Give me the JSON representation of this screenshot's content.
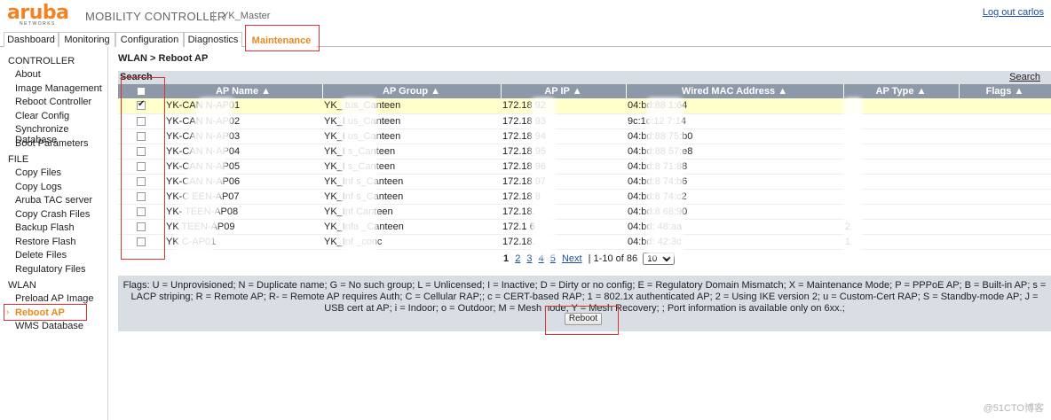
{
  "header": {
    "brand": "aruba",
    "brand_sub": "NETWORKS",
    "app_title": "MOBILITY CONTROLLER",
    "separator": "|",
    "controller_name": "YK_Master",
    "logout": "Log out carlos"
  },
  "tabs": [
    {
      "label": "Dashboard"
    },
    {
      "label": "Monitoring"
    },
    {
      "label": "Configuration"
    },
    {
      "label": "Diagnostics"
    },
    {
      "label": "Maintenance",
      "active": true
    }
  ],
  "sidebar": {
    "controller": {
      "title": "CONTROLLER",
      "items": [
        "About",
        "Image Management",
        "Reboot Controller",
        "Clear Config",
        "Synchronize Database",
        "Boot Parameters"
      ]
    },
    "file": {
      "title": "FILE",
      "items": [
        "Copy Files",
        "Copy Logs",
        "Aruba TAC server",
        "Copy Crash Files",
        "Backup Flash",
        "Restore Flash",
        "Delete Files",
        "Regulatory Files"
      ]
    },
    "wlan": {
      "title": "WLAN",
      "items": [
        "Preload AP Image",
        "Reboot AP",
        "WMS Database"
      ],
      "active_item": "Reboot AP",
      "active_marker": "›"
    }
  },
  "breadcrumb": "WLAN > Reboot AP",
  "search": {
    "left_label": "Search",
    "right_link": "Search"
  },
  "table": {
    "columns": [
      "",
      "AP Name ▲",
      "AP Group ▲",
      "AP IP ▲",
      "Wired MAC Address ▲",
      "AP Type ▲",
      "Flags ▲"
    ],
    "rows": [
      {
        "checked": true,
        "name": "YK-CAN      N-AP01",
        "group": "YK_      tus_Canteen",
        "ip": "172.18      92",
        "mac": "04:bd:88      1:64",
        "type": "",
        "flags": ""
      },
      {
        "checked": false,
        "name": "YK-CAN      N-AP02",
        "group": "YK_I      us_Canteen",
        "ip": "172.18      93",
        "mac": "9c:1c:12      7:14",
        "type": "",
        "flags": ""
      },
      {
        "checked": false,
        "name": "YK-CAN      N-AP03",
        "group": "YK_I      us_Canteen",
        "ip": "172.18      94",
        "mac": "04:bd:88      75:b0",
        "type": "",
        "flags": ""
      },
      {
        "checked": false,
        "name": "YK-CAN      N-AP04",
        "group": "YK_I      s_Canteen",
        "ip": "172.18      95",
        "mac": "04:bd:88      57:e8",
        "type": "",
        "flags": ""
      },
      {
        "checked": false,
        "name": "YK-CAN      N-AP05",
        "group": "YK_I      s_Canteen",
        "ip": "172.18      96",
        "mac": "04:bd:8      71:88",
        "type": "",
        "flags": ""
      },
      {
        "checked": false,
        "name": "YK-CAN      N-AP06",
        "group": "YK_Inf      s_Canteen",
        "ip": "172.18      97",
        "mac": "04:bd:8      74:b6",
        "type": "",
        "flags": ""
      },
      {
        "checked": false,
        "name": "YK-C      EEN-AP07",
        "group": "YK_Inf      s_Canteen",
        "ip": "172.18      8",
        "mac": "04:bd:8      74:c2",
        "type": "",
        "flags": ""
      },
      {
        "checked": false,
        "name": "YK-      TEEN-AP08",
        "group": "YK_Inf      Canteen",
        "ip": "172.18.",
        "mac": "04:bd:8      68:90",
        "type": "",
        "flags": ""
      },
      {
        "checked": false,
        "name": "YK      TEEN-AP09",
        "group": "YK_Infa      _Canteen",
        "ip": "172.1      6",
        "mac": "04:bd:      48:aa",
        "type": "2",
        "flags": ""
      },
      {
        "checked": false,
        "name": "YK      C-AP01",
        "group": "YK_Inf      _conc",
        "ip": "172.18.",
        "mac": "04:bd:      42:3c",
        "type": "1",
        "flags": ""
      }
    ]
  },
  "pager": {
    "current": "1",
    "pages": [
      "2",
      "3",
      "4",
      "5"
    ],
    "next": "Next",
    "sep": "|",
    "range": "1-10 of 86",
    "per_page": "10"
  },
  "flags_legend": "Flags: U = Unprovisioned; N = Duplicate name; G = No such group; L = Unlicensed; I = Inactive; D = Dirty or no config; E = Regulatory Domain Mismatch; X = Maintenance Mode; P = PPPoE AP; B = Built-in AP; s = LACP striping; R = Remote AP; R- = Remote AP requires Auth; C = Cellular RAP;; c = CERT-based RAP; 1 = 802.1x authenticated AP; 2 = Using IKE version 2; u = Custom-Cert RAP; S = Standby-mode AP; J = USB cert at AP; i = Indoor; o = Outdoor; M = Mesh node; Y = Mesh Recovery; ; Port information is available only on 6xx.;",
  "reboot_button": "Reboot",
  "watermark": "@51CTO博客",
  "colors": {
    "accent": "#e58a1f",
    "brand": "#f58220",
    "header_row": "#8d98a8",
    "highlight": "#ffffcc",
    "callout": "#dd3333"
  }
}
